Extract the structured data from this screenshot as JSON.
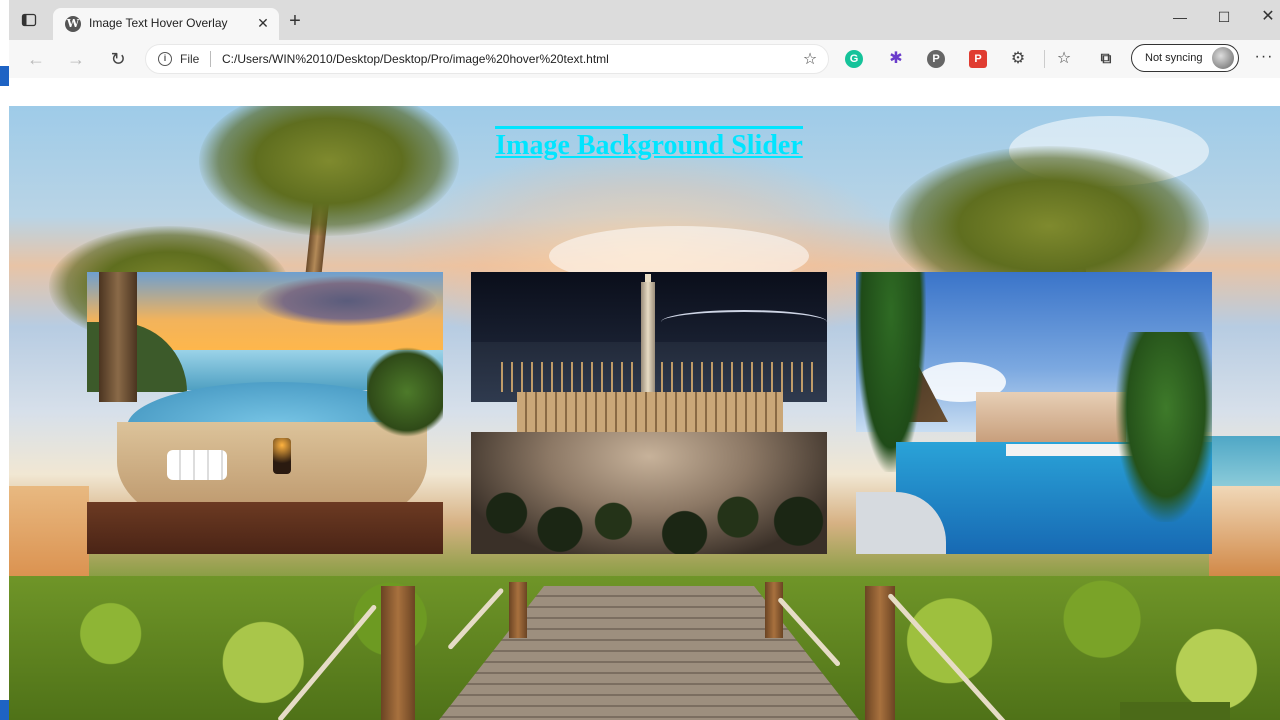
{
  "browser": {
    "tab": {
      "title": "Image Text Hover Overlay",
      "favicon": "wordpress-icon",
      "close_glyph": "✕"
    },
    "new_tab_glyph": "+",
    "window_controls": {
      "minimize": "—",
      "maximize": "☐",
      "close": "✕"
    },
    "toolbar": {
      "back_glyph": "←",
      "forward_glyph": "→",
      "reload_glyph": "↻",
      "info_glyph": "i",
      "file_label": "File",
      "url": "C:/Users/WIN%2010/Desktop/Desktop/Pro/image%20hover%20text.html",
      "favorite_add_glyph": "☆",
      "extensions": [
        {
          "name": "grammarly-icon",
          "glyph": "G"
        },
        {
          "name": "puzzle-extension-icon",
          "glyph": "✱"
        },
        {
          "name": "pinterest-icon",
          "glyph": "P"
        },
        {
          "name": "red-extension-icon",
          "glyph": "P"
        },
        {
          "name": "extensions-icon",
          "glyph": "⚙"
        },
        {
          "name": "favorites-icon",
          "glyph": "☆"
        },
        {
          "name": "collections-icon",
          "glyph": "⧉"
        }
      ],
      "profile_label": "Not syncing",
      "more_glyph": "···"
    }
  },
  "page": {
    "heading": "Image Background Slider",
    "heading_color": "#00e5ff",
    "gallery": [
      {
        "name": "infinity-pool-sunset-photo"
      },
      {
        "name": "night-city-ferry-building-photo"
      },
      {
        "name": "tropical-resort-pool-photo"
      }
    ]
  }
}
